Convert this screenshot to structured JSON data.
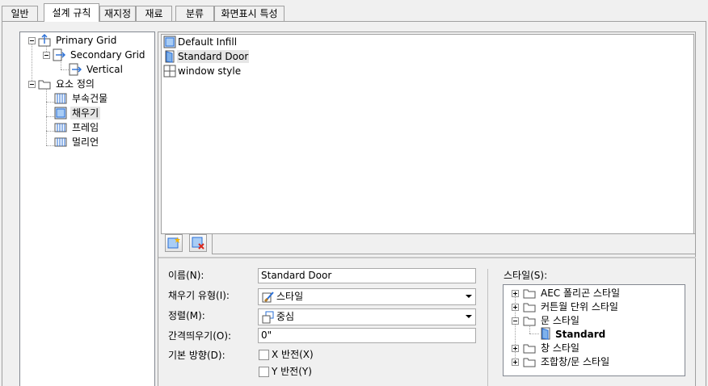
{
  "tabs": [
    {
      "label": "일반"
    },
    {
      "label": "설계 규칙"
    },
    {
      "label": "재지정"
    },
    {
      "label": "재료"
    },
    {
      "label": "분류"
    },
    {
      "label": "화면표시 특성"
    }
  ],
  "grid_tree": {
    "primary": "Primary Grid",
    "secondary": "Secondary Grid",
    "vertical": "Vertical",
    "elements_def": "요소 정의",
    "elements": [
      "부속건물",
      "채우기",
      "프레임",
      "멀리언"
    ]
  },
  "infill_list": [
    "Default Infill",
    "Standard Door",
    "window style"
  ],
  "toolbar": {
    "add_icon": "new-infill-icon",
    "delete_icon": "delete-infill-icon"
  },
  "properties": {
    "name_label": "이름(N):",
    "name_value": "Standard Door",
    "infill_type_label": "채우기 유형(I):",
    "infill_type_value": "스타일",
    "alignment_label": "정렬(M):",
    "alignment_value": "중심",
    "spacing_label": "간격띄우기(O):",
    "spacing_value": "0\"",
    "orientation_label": "기본 방향(D):",
    "flip_x_label": "X 반전(X)",
    "flip_y_label": "Y 반전(Y)"
  },
  "style_tree": {
    "label": "스타일(S):",
    "items": [
      "AEC 폴리곤 스타일",
      "커튼월 단위 스타일",
      "문 스타일",
      "Standard",
      "창 스타일",
      "조합창/문 스타일"
    ]
  },
  "colors": {
    "accent": "#3d7bd1",
    "tree_line": "#a0a0a0"
  }
}
